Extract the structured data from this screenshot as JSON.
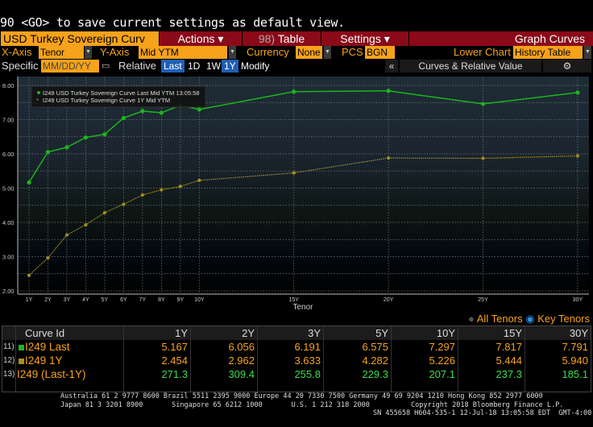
{
  "message": "90 <GO> to save current settings as default view.",
  "toolbar": {
    "security": "USD Turkey Sovereign Curv",
    "actions": "Actions ▾",
    "table_num": "98)",
    "table": "Table",
    "settings": "Settings ▾",
    "graph_curves": "Graph Curves"
  },
  "options": {
    "xaxis_label": "X-Axis",
    "xaxis_value": "Tenor",
    "yaxis_label": "Y-Axis",
    "yaxis_value": "Mid YTM",
    "currency_label": "Currency",
    "currency_value": "None",
    "pcs_label": "PCS",
    "pcs_value": "BGN",
    "lower_chart_label": "Lower Chart",
    "lower_chart_value": "History Table"
  },
  "dates": {
    "specific_label": "Specific",
    "date_placeholder": "MM/DD/YY",
    "relative_label": "Relative",
    "buttons": [
      "Last",
      "1D",
      "1W",
      "1Y"
    ],
    "modify": "Modify",
    "collapse": "«",
    "panel_title": "Curves & Relative Value"
  },
  "chart_data": {
    "type": "line",
    "xlabel": "Tenor",
    "ylabel": "",
    "ylim": [
      2,
      8
    ],
    "yticks": [
      "2.00",
      "3.00",
      "4.00",
      "5.00",
      "6.00",
      "7.00",
      "8.00"
    ],
    "xticks": [
      "1Y",
      "2Y",
      "3Y",
      "4Y",
      "5Y",
      "6Y",
      "7Y",
      "8Y",
      "9Y",
      "10Y",
      "15Y",
      "20Y",
      "25Y",
      "30Y"
    ],
    "x": [
      1,
      2,
      3,
      4,
      5,
      6,
      7,
      8,
      9,
      10,
      15,
      20,
      25,
      30
    ],
    "legend_position": "top-left",
    "series": [
      {
        "name": "I249 USD Turkey Sovereign Curve Last Mid YTM 13:05:58",
        "color": "#1db41d",
        "values": [
          5.167,
          6.056,
          6.191,
          6.48,
          6.575,
          7.05,
          7.25,
          7.2,
          7.42,
          7.297,
          7.817,
          7.84,
          7.46,
          7.791
        ]
      },
      {
        "name": "I249 USD Turkey Sovereign Curve 1Y Mid YTM",
        "color": "#a8901c",
        "values": [
          2.454,
          2.962,
          3.633,
          3.93,
          4.282,
          4.53,
          4.8,
          4.95,
          5.05,
          5.226,
          5.444,
          5.88,
          5.87,
          5.94
        ]
      }
    ]
  },
  "tenor_toggle": {
    "all": "All Tenors",
    "key": "Key Tenors"
  },
  "table": {
    "header": "Curve Id",
    "columns": [
      "1Y",
      "2Y",
      "3Y",
      "5Y",
      "10Y",
      "15Y",
      "30Y"
    ],
    "rows": [
      {
        "num": "11)",
        "name": "I249 Last",
        "color": "#1db41d",
        "values": [
          "5.167",
          "6.056",
          "6.191",
          "6.575",
          "7.297",
          "7.817",
          "7.791"
        ]
      },
      {
        "num": "12)",
        "name": "I249 1Y",
        "color": "#a8901c",
        "values": [
          "2.454",
          "2.962",
          "3.633",
          "4.282",
          "5.226",
          "5.444",
          "5.940"
        ]
      },
      {
        "num": "13)",
        "name": "I249 (Last-1Y)",
        "values": [
          "271.3",
          "309.4",
          "255.8",
          "229.3",
          "207.1",
          "237.3",
          "185.1"
        ]
      }
    ]
  },
  "footer": {
    "line1": "Australia 61 2 9777 8600 Brazil 5511 2395 9000 Europe 44 20 7330 7500 Germany 49 69 9204 1210 Hong Kong 852 2977 6000",
    "line2": "Japan 81 3 3201 8900       Singapore 65 6212 1000       U.S. 1 212 318 2000          Copyright 2018 Bloomberg Finance L.P.",
    "line3": "SN 455658 H604-535-1 12-Jul-18 13:05:58 EDT  GMT-4:00"
  }
}
